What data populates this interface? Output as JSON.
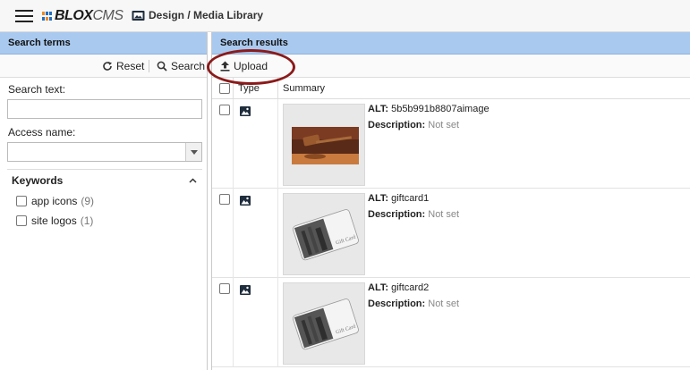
{
  "header": {
    "logo_blox": "BLOX",
    "logo_cms": "CMS",
    "breadcrumb": "Design / Media Library"
  },
  "search_panel": {
    "title": "Search terms",
    "reset_label": "Reset",
    "search_label": "Search",
    "search_text_label": "Search text:",
    "search_text_value": "",
    "access_name_label": "Access name:",
    "access_name_value": "",
    "keywords": {
      "title": "Keywords",
      "items": [
        {
          "label": "app icons",
          "count": "(9)"
        },
        {
          "label": "site logos",
          "count": "(1)"
        }
      ]
    }
  },
  "results_panel": {
    "title": "Search results",
    "upload_label": "Upload",
    "columns": {
      "type": "Type",
      "summary": "Summary"
    },
    "rows": [
      {
        "alt_label": "ALT:",
        "alt_value": "5b5b991b8807aimage",
        "desc_label": "Description:",
        "desc_value": "Not set"
      },
      {
        "alt_label": "ALT:",
        "alt_value": "giftcard1",
        "desc_label": "Description:",
        "desc_value": "Not set"
      },
      {
        "alt_label": "ALT:",
        "alt_value": "giftcard2",
        "desc_label": "Description:",
        "desc_value": "Not set"
      }
    ],
    "gift_card_text": "Gift Card"
  },
  "colors": {
    "panel_header": "#a9c9ef",
    "annotation_circle": "#8b1a1a"
  }
}
